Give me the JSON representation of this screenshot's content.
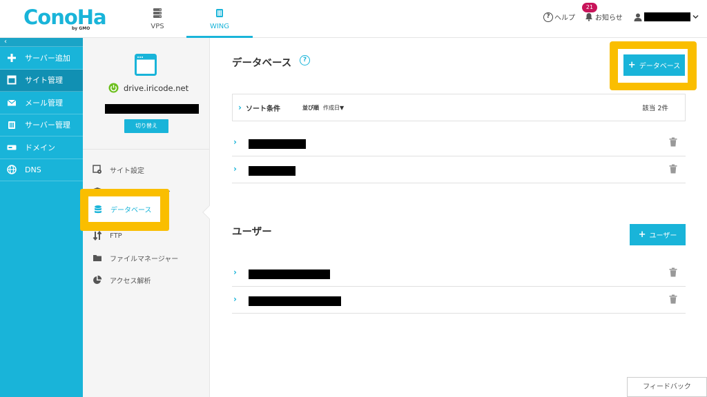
{
  "header": {
    "logo_text": "ConoHa",
    "logo_sub": "by GMO",
    "nav": [
      {
        "label": "VPS",
        "icon": "server-icon"
      },
      {
        "label": "WING",
        "icon": "wing-icon"
      }
    ],
    "help_label": "ヘルプ",
    "notifications_label": "お知らせ",
    "notifications_count": "21"
  },
  "sidebar": {
    "items": [
      {
        "label": "サーバー追加",
        "icon": "plus-icon"
      },
      {
        "label": "サイト管理",
        "icon": "site-icon"
      },
      {
        "label": "メール管理",
        "icon": "mail-icon"
      },
      {
        "label": "サーバー管理",
        "icon": "server-manage-icon"
      },
      {
        "label": "ドメイン",
        "icon": "domain-icon"
      },
      {
        "label": "DNS",
        "icon": "globe-icon"
      }
    ]
  },
  "site_panel": {
    "domain": "drive.iricode.net",
    "switch_label": "切り替え",
    "menu": [
      {
        "label": "サイト設定",
        "icon": "site-settings-icon"
      },
      {
        "label": "サイトセキュリティ",
        "icon": "shield-icon"
      },
      {
        "label": "データベース",
        "icon": "database-icon"
      },
      {
        "label": "FTP",
        "icon": "ftp-icon"
      },
      {
        "label": "ファイルマネージャー",
        "icon": "folder-icon"
      },
      {
        "label": "アクセス解析",
        "icon": "pie-chart-icon"
      }
    ]
  },
  "main": {
    "database_title": "データベース",
    "add_database_label": "データベース",
    "sort_label": "ソート条件",
    "sort_key": "並び順",
    "sort_value": "作成日▼",
    "count_label": "該当 2件",
    "user_title": "ユーザー",
    "add_user_label": "ユーザー",
    "feedback_label": "フィードバック"
  },
  "colors": {
    "accent": "#19b4d9",
    "highlight": "#fabe00",
    "badge": "#c8145a"
  }
}
